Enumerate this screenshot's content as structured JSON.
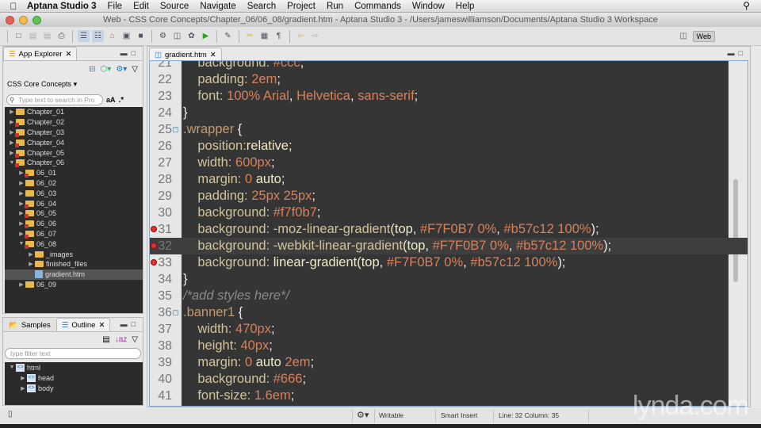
{
  "menubar": {
    "app_name": "Aptana Studio 3",
    "items": [
      "File",
      "Edit",
      "Source",
      "Navigate",
      "Search",
      "Project",
      "Run",
      "Commands",
      "Window",
      "Help"
    ]
  },
  "window": {
    "title": "Web - CSS Core Concepts/Chapter_06/06_08/gradient.htm - Aptana Studio 3 - /Users/jameswilliamson/Documents/Aptana Studio 3 Workspace"
  },
  "perspective": {
    "label": "Web"
  },
  "app_explorer": {
    "tab_label": "App Explorer",
    "project": "CSS Core Concepts",
    "search_placeholder": "Type text to search in Pro",
    "case_toggle": "aA",
    "regex_toggle": ".*",
    "tree": [
      {
        "label": "Chapter_01",
        "depth": 0,
        "expanded": false,
        "type": "folder",
        "error": false
      },
      {
        "label": "Chapter_02",
        "depth": 0,
        "expanded": false,
        "type": "folder",
        "error": true
      },
      {
        "label": "Chapter_03",
        "depth": 0,
        "expanded": false,
        "type": "folder",
        "error": true
      },
      {
        "label": "Chapter_04",
        "depth": 0,
        "expanded": false,
        "type": "folder",
        "error": true
      },
      {
        "label": "Chapter_05",
        "depth": 0,
        "expanded": false,
        "type": "folder",
        "error": true
      },
      {
        "label": "Chapter_06",
        "depth": 0,
        "expanded": true,
        "type": "folder",
        "error": true
      },
      {
        "label": "06_01",
        "depth": 1,
        "expanded": false,
        "type": "folder",
        "error": true
      },
      {
        "label": "06_02",
        "depth": 1,
        "expanded": false,
        "type": "folder",
        "error": false
      },
      {
        "label": "06_03",
        "depth": 1,
        "expanded": false,
        "type": "folder",
        "error": false
      },
      {
        "label": "06_04",
        "depth": 1,
        "expanded": false,
        "type": "folder",
        "error": true
      },
      {
        "label": "06_05",
        "depth": 1,
        "expanded": false,
        "type": "folder",
        "error": true
      },
      {
        "label": "06_06",
        "depth": 1,
        "expanded": false,
        "type": "folder",
        "error": true
      },
      {
        "label": "06_07",
        "depth": 1,
        "expanded": false,
        "type": "folder",
        "error": true
      },
      {
        "label": "06_08",
        "depth": 1,
        "expanded": true,
        "type": "folder",
        "error": true
      },
      {
        "label": "_images",
        "depth": 2,
        "expanded": false,
        "type": "folder",
        "error": false
      },
      {
        "label": "finished_files",
        "depth": 2,
        "expanded": false,
        "type": "folder",
        "error": false
      },
      {
        "label": "gradient.htm",
        "depth": 2,
        "type": "file",
        "selected": true,
        "error": true
      },
      {
        "label": "06_09",
        "depth": 1,
        "expanded": false,
        "type": "folder",
        "error": false
      }
    ]
  },
  "outline": {
    "tabs": [
      "Samples",
      "Outline"
    ],
    "filter_placeholder": "type filter text",
    "tree": [
      {
        "label": "html",
        "depth": 0,
        "expanded": true
      },
      {
        "label": "head",
        "depth": 1,
        "expanded": false
      },
      {
        "label": "body",
        "depth": 1,
        "expanded": false
      }
    ]
  },
  "editor": {
    "tab_label": "gradient.htm",
    "current_line": 32,
    "lines": [
      {
        "n": 21,
        "tokens": [
          [
            "prop",
            "    background: "
          ],
          [
            "val",
            "#ccc"
          ],
          [
            "pn",
            ";"
          ]
        ]
      },
      {
        "n": 22,
        "tokens": [
          [
            "prop",
            "    padding: "
          ],
          [
            "val",
            "2em"
          ],
          [
            "pn",
            ";"
          ]
        ]
      },
      {
        "n": 23,
        "tokens": [
          [
            "prop",
            "    font: "
          ],
          [
            "val",
            "100% Arial"
          ],
          [
            "pn",
            ", "
          ],
          [
            "val",
            "Helvetica"
          ],
          [
            "pn",
            ", "
          ],
          [
            "val",
            "sans-serif"
          ],
          [
            "pn",
            ";"
          ]
        ]
      },
      {
        "n": 24,
        "tokens": [
          [
            "pn",
            "}"
          ]
        ]
      },
      {
        "n": 25,
        "fold": true,
        "tokens": [
          [
            "sel-",
            ".wrapper "
          ],
          [
            "pn",
            "{"
          ]
        ]
      },
      {
        "n": 26,
        "tokens": [
          [
            "prop",
            "    position:"
          ],
          [
            "kw",
            "relative"
          ],
          [
            "pn",
            ";"
          ]
        ]
      },
      {
        "n": 27,
        "tokens": [
          [
            "prop",
            "    width: "
          ],
          [
            "val",
            "600px"
          ],
          [
            "pn",
            ";"
          ]
        ]
      },
      {
        "n": 28,
        "tokens": [
          [
            "prop",
            "    margin: "
          ],
          [
            "val",
            "0 "
          ],
          [
            "kw",
            "auto"
          ],
          [
            "pn",
            ";"
          ]
        ]
      },
      {
        "n": 29,
        "tokens": [
          [
            "prop",
            "    padding: "
          ],
          [
            "val",
            "25px 25px"
          ],
          [
            "pn",
            ";"
          ]
        ]
      },
      {
        "n": 30,
        "tokens": [
          [
            "prop",
            "    background: "
          ],
          [
            "val",
            "#f7f0b7"
          ],
          [
            "pn",
            ";"
          ]
        ]
      },
      {
        "n": 31,
        "error": true,
        "tokens": [
          [
            "prop",
            "    background: -moz-linear-gradient"
          ],
          [
            "kw",
            "(top"
          ],
          [
            "pn",
            ", "
          ],
          [
            "val",
            "#F7F0B7 0%"
          ],
          [
            "pn",
            ", "
          ],
          [
            "val",
            "#b57c12 100%"
          ],
          [
            "pn",
            ");"
          ]
        ]
      },
      {
        "n": 32,
        "error": true,
        "tokens": [
          [
            "prop",
            "    background: -webkit-linear-gradient"
          ],
          [
            "kw",
            "(top"
          ],
          [
            "pn",
            ", "
          ],
          [
            "val",
            "#F7F0B7 0%"
          ],
          [
            "pn",
            ", "
          ],
          [
            "val",
            "#b57c12 100%"
          ],
          [
            "pn",
            ");"
          ]
        ]
      },
      {
        "n": 33,
        "error": true,
        "tokens": [
          [
            "prop",
            "    background: "
          ],
          [
            "kw",
            "linear-gradient(top"
          ],
          [
            "pn",
            ", "
          ],
          [
            "val",
            "#F7F0B7 0%"
          ],
          [
            "pn",
            ", "
          ],
          [
            "val",
            "#b57c12 100%"
          ],
          [
            "pn",
            ");"
          ]
        ]
      },
      {
        "n": 34,
        "tokens": [
          [
            "pn",
            "}"
          ]
        ]
      },
      {
        "n": 35,
        "tokens": [
          [
            "cm",
            "/*add styles here*/"
          ]
        ]
      },
      {
        "n": 36,
        "fold": true,
        "tokens": [
          [
            "sel-",
            ".banner1 "
          ],
          [
            "pn",
            "{"
          ]
        ]
      },
      {
        "n": 37,
        "tokens": [
          [
            "prop",
            "    width: "
          ],
          [
            "val",
            "470px"
          ],
          [
            "pn",
            ";"
          ]
        ]
      },
      {
        "n": 38,
        "tokens": [
          [
            "prop",
            "    height: "
          ],
          [
            "val",
            "40px"
          ],
          [
            "pn",
            ";"
          ]
        ]
      },
      {
        "n": 39,
        "tokens": [
          [
            "prop",
            "    margin: "
          ],
          [
            "val",
            "0 "
          ],
          [
            "kw",
            "auto "
          ],
          [
            "val",
            "2em"
          ],
          [
            "pn",
            ";"
          ]
        ]
      },
      {
        "n": 40,
        "tokens": [
          [
            "prop",
            "    background: "
          ],
          [
            "val",
            "#666"
          ],
          [
            "pn",
            ";"
          ]
        ]
      },
      {
        "n": 41,
        "tokens": [
          [
            "prop",
            "    font-size: "
          ],
          [
            "val",
            "1.6em"
          ],
          [
            "pn",
            ";"
          ]
        ]
      }
    ]
  },
  "statusbar": {
    "mode": "Writable",
    "insert": "Smart Insert",
    "position": "Line: 32 Column: 35"
  },
  "watermark": "lynda.com"
}
